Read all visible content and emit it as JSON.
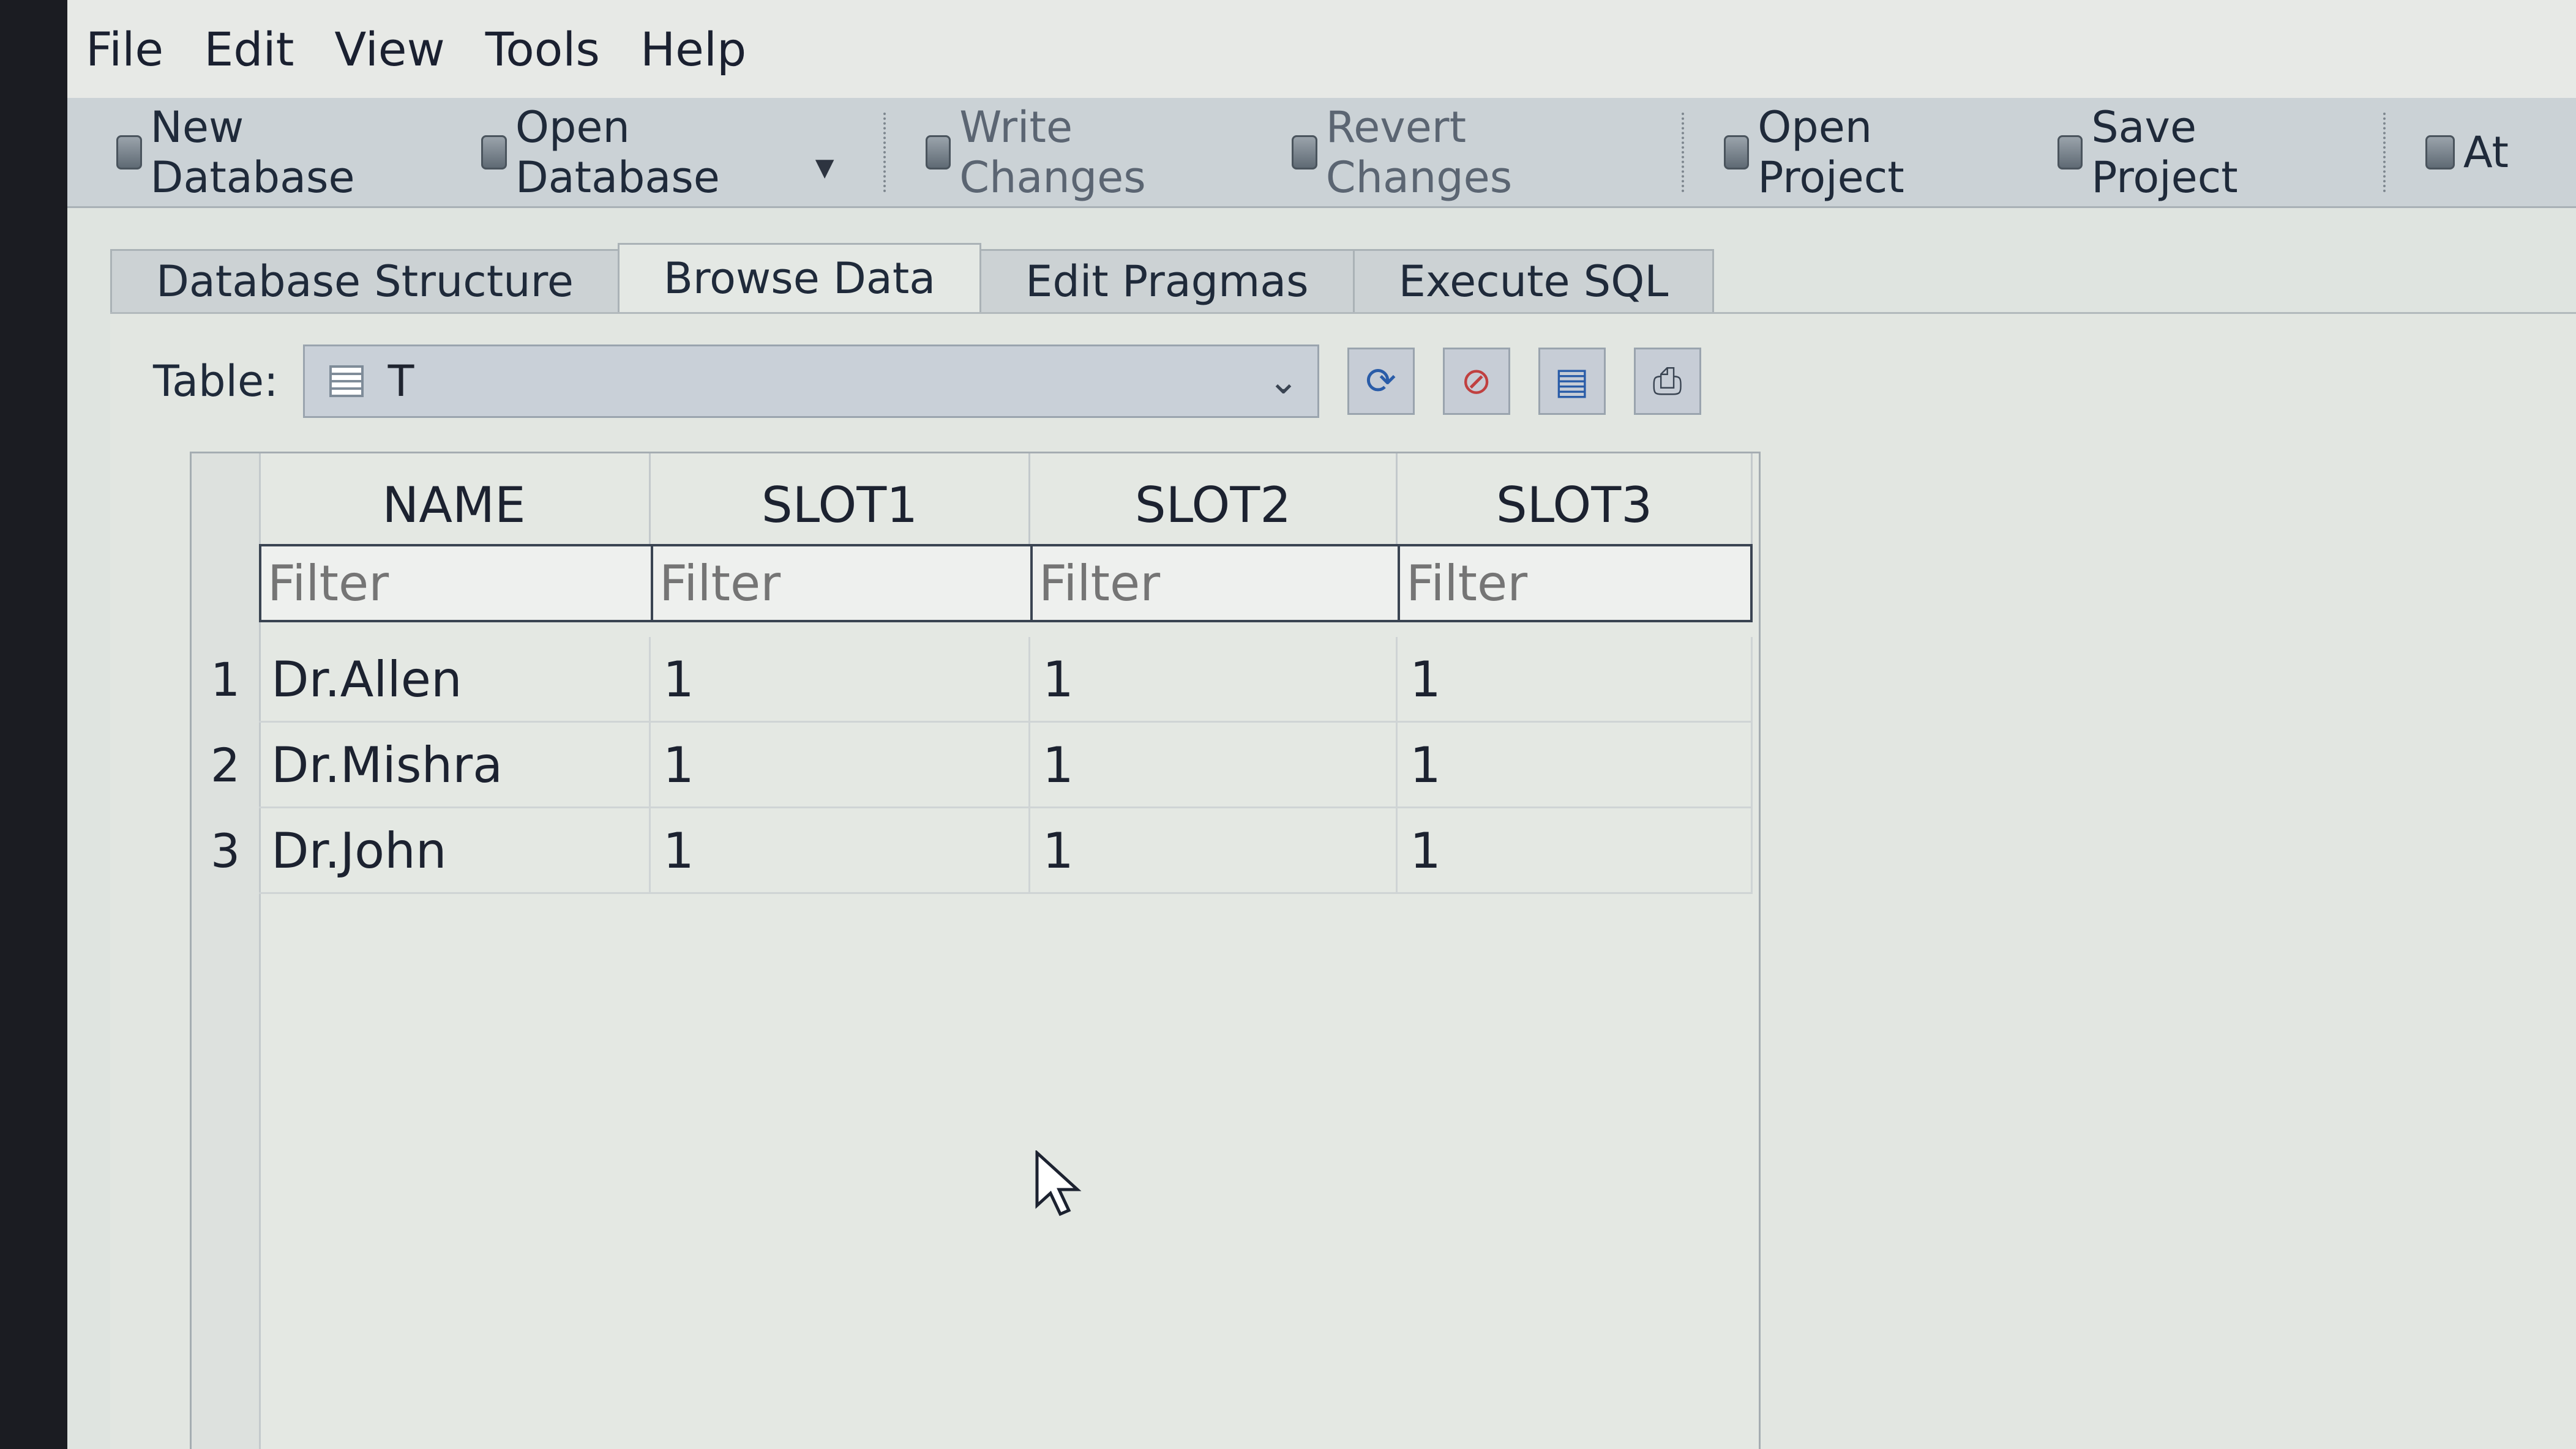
{
  "menu": [
    "File",
    "Edit",
    "View",
    "Tools",
    "Help"
  ],
  "toolbar": {
    "new_database": "New Database",
    "open_database": "Open Database",
    "write_changes": "Write Changes",
    "revert_changes": "Revert Changes",
    "open_project": "Open Project",
    "save_project": "Save Project",
    "attach_truncated": "At"
  },
  "tabs": [
    "Database Structure",
    "Browse Data",
    "Edit Pragmas",
    "Execute SQL"
  ],
  "active_tab": "Browse Data",
  "browse": {
    "table_label": "Table:",
    "table_value": "T",
    "actions": [
      "refresh-icon",
      "clear-filter-icon",
      "save-table-icon",
      "print-icon"
    ]
  },
  "grid": {
    "columns": [
      "NAME",
      "SLOT1",
      "SLOT2",
      "SLOT3"
    ],
    "filter_placeholder": "Filter",
    "rows": [
      {
        "n": "1",
        "cells": [
          "Dr.Allen",
          "1",
          "1",
          "1"
        ]
      },
      {
        "n": "2",
        "cells": [
          "Dr.Mishra",
          "1",
          "1",
          "1"
        ]
      },
      {
        "n": "3",
        "cells": [
          "Dr.John",
          "1",
          "1",
          "1"
        ]
      }
    ]
  }
}
